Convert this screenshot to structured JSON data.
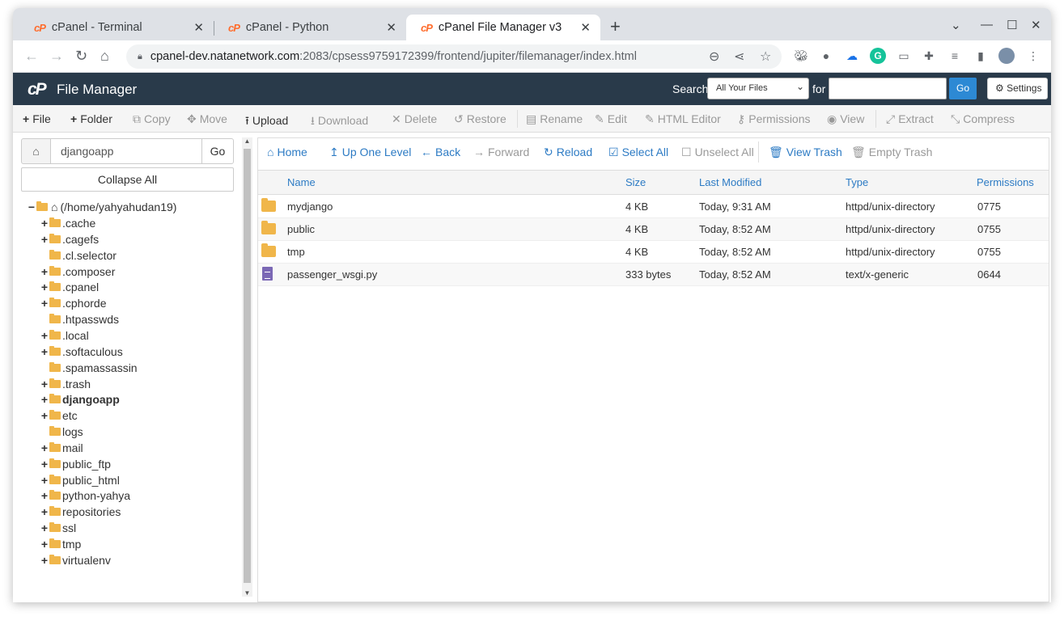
{
  "browser": {
    "tabs": [
      {
        "label": "cPanel - Terminal",
        "favicon": "cP"
      },
      {
        "label": "cPanel - Python",
        "favicon": "cP"
      },
      {
        "label": "cPanel File Manager v3",
        "favicon": "cP"
      }
    ],
    "url_host": "cpanel-dev.natanetwork.com",
    "url_rest": ":2083/cpsess9759172399/frontend/jupiter/filemanager/index.html"
  },
  "header": {
    "logo": "cP",
    "title": "File Manager",
    "search_label": "Search",
    "search_scope": "All Your Files",
    "for_label": "for",
    "go_label": "Go",
    "settings_label": "Settings"
  },
  "toolbar": {
    "file": "File",
    "folder": "Folder",
    "copy": "Copy",
    "move": "Move",
    "upload": "Upload",
    "download": "Download",
    "delete": "Delete",
    "restore": "Restore",
    "rename": "Rename",
    "edit": "Edit",
    "html_editor": "HTML Editor",
    "permissions": "Permissions",
    "view": "View",
    "extract": "Extract",
    "compress": "Compress"
  },
  "sidebar": {
    "path_value": "djangoapp",
    "go_label": "Go",
    "collapse_label": "Collapse All",
    "root_label": "(/home/yahyahudan19)",
    "items": [
      {
        "label": ".cache",
        "toggle": "+"
      },
      {
        "label": ".cagefs",
        "toggle": "+"
      },
      {
        "label": ".cl.selector",
        "toggle": ""
      },
      {
        "label": ".composer",
        "toggle": "+"
      },
      {
        "label": ".cpanel",
        "toggle": "+"
      },
      {
        "label": ".cphorde",
        "toggle": "+"
      },
      {
        "label": ".htpasswds",
        "toggle": ""
      },
      {
        "label": ".local",
        "toggle": "+"
      },
      {
        "label": ".softaculous",
        "toggle": "+"
      },
      {
        "label": ".spamassassin",
        "toggle": ""
      },
      {
        "label": ".trash",
        "toggle": "+"
      },
      {
        "label": "djangoapp",
        "toggle": "+"
      },
      {
        "label": "etc",
        "toggle": "+"
      },
      {
        "label": "logs",
        "toggle": ""
      },
      {
        "label": "mail",
        "toggle": "+"
      },
      {
        "label": "public_ftp",
        "toggle": "+"
      },
      {
        "label": "public_html",
        "toggle": "+"
      },
      {
        "label": "python-yahya",
        "toggle": "+"
      },
      {
        "label": "repositories",
        "toggle": "+"
      },
      {
        "label": "ssl",
        "toggle": "+"
      },
      {
        "label": "tmp",
        "toggle": "+"
      },
      {
        "label": "virtualenv",
        "toggle": "+"
      }
    ]
  },
  "nav": {
    "home": "Home",
    "up": "Up One Level",
    "back": "Back",
    "forward": "Forward",
    "reload": "Reload",
    "select_all": "Select All",
    "unselect_all": "Unselect All",
    "view_trash": "View Trash",
    "empty_trash": "Empty Trash"
  },
  "table": {
    "headers": {
      "name": "Name",
      "size": "Size",
      "modified": "Last Modified",
      "type": "Type",
      "perms": "Permissions"
    },
    "rows": [
      {
        "name": "mydjango",
        "size": "4 KB",
        "modified": "Today, 9:31 AM",
        "type": "httpd/unix-directory",
        "perms": "0775"
      },
      {
        "name": "public",
        "size": "4 KB",
        "modified": "Today, 8:52 AM",
        "type": "httpd/unix-directory",
        "perms": "0755"
      },
      {
        "name": "tmp",
        "size": "4 KB",
        "modified": "Today, 8:52 AM",
        "type": "httpd/unix-directory",
        "perms": "0755"
      },
      {
        "name": "passenger_wsgi.py",
        "size": "333 bytes",
        "modified": "Today, 8:52 AM",
        "type": "text/x-generic",
        "perms": "0644"
      }
    ]
  },
  "colors": {
    "header_bg": "#293a4a",
    "link": "#2d7bc4",
    "folder": "#f0b64a",
    "go_button": "#2d89d4"
  }
}
